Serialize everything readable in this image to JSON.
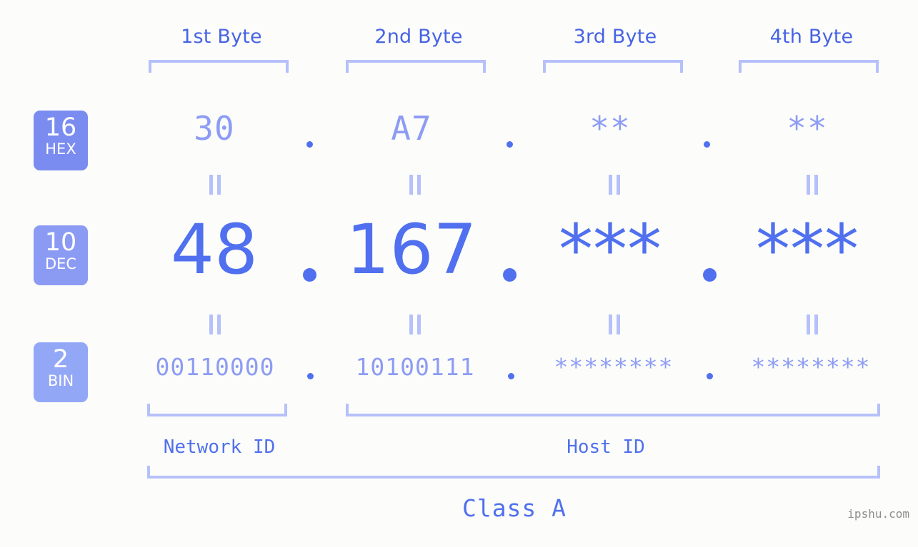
{
  "colors": {
    "background": "#fcfdfa",
    "header_text": "#4763e4",
    "bracket": "#b6c0fb",
    "value_light": "#8d9cf4",
    "value_strong": "#5070ef",
    "badge_hex": "#7b8cf0",
    "badge_dec": "#8b9bf4",
    "badge_bin": "#93a7f7",
    "watermark": "#8d8d8d"
  },
  "byte_headers": [
    {
      "label": "1st Byte"
    },
    {
      "label": "2nd Byte"
    },
    {
      "label": "3rd Byte"
    },
    {
      "label": "4th Byte"
    }
  ],
  "bases": [
    {
      "number": "16",
      "abbr": "HEX"
    },
    {
      "number": "10",
      "abbr": "DEC"
    },
    {
      "number": "2",
      "abbr": "BIN"
    }
  ],
  "rows": {
    "hex": {
      "base_number": "16",
      "base_abbr": "HEX",
      "values": [
        "30",
        "A7",
        "**",
        "**"
      ],
      "separator": "."
    },
    "dec": {
      "base_number": "10",
      "base_abbr": "DEC",
      "values": [
        "48",
        "167",
        "***",
        "***"
      ],
      "separator": "."
    },
    "bin": {
      "base_number": "2",
      "base_abbr": "BIN",
      "values": [
        "00110000",
        "10100111",
        "********",
        "********"
      ],
      "separator": "."
    }
  },
  "equality_marks": {
    "glyph": "||",
    "row1": [
      "||",
      "||",
      "||",
      "||"
    ],
    "row2": [
      "||",
      "||",
      "||",
      "||"
    ]
  },
  "segments": {
    "network_id": "Network ID",
    "host_id": "Host ID"
  },
  "class_label": "Class A",
  "watermark": "ipshu.com"
}
